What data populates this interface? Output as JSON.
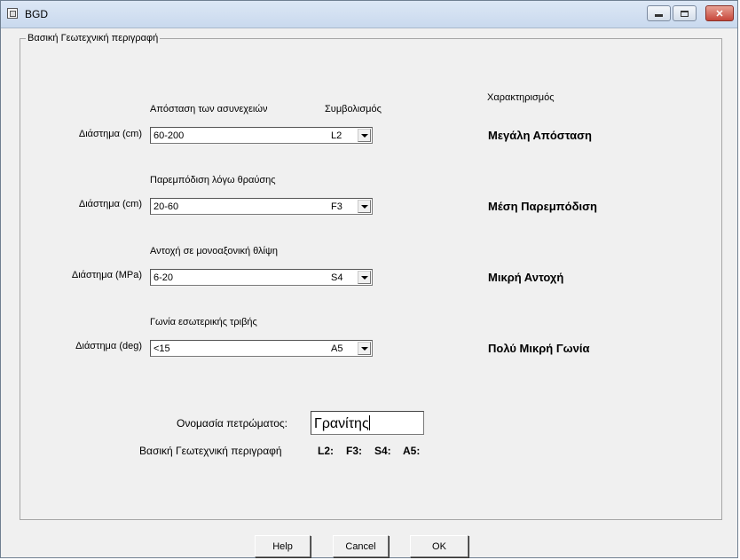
{
  "window": {
    "title": "BGD"
  },
  "group": {
    "legend": "Βασική Γεωτεχνική περιγραφή"
  },
  "headers": {
    "characterization": "Χαρακτηρισμός",
    "symbolism": "Συμβολισμός"
  },
  "rows": [
    {
      "heading": "Απόσταση των ασυνεχειών",
      "label": "Διάστημα (cm)",
      "value": "60-200",
      "symbol": "L2",
      "characterization": "Μεγάλη Απόσταση"
    },
    {
      "heading": "Παρεμπόδιση λόγω θραύσης",
      "label": "Διάστημα (cm)",
      "value": "20-60",
      "symbol": "F3",
      "characterization": "Μέση Παρεμπόδιση"
    },
    {
      "heading": "Αντοχή σε μονοαξονική θλίψη",
      "label": "Διάστημα (MPa)",
      "value": "6-20",
      "symbol": "S4",
      "characterization": "Μικρή Αντοχή"
    },
    {
      "heading": "Γωνία εσωτερικής τριβής",
      "label": "Διάστημα (deg)",
      "value": "<15",
      "symbol": "A5",
      "characterization": "Πολύ Μικρή Γωνία"
    }
  ],
  "rock_name": {
    "label": "Ονομασία πετρώματος:",
    "value": "Γρανίτης"
  },
  "summary": {
    "label": "Βασική Γεωτεχνική περιγραφή",
    "codes": [
      "L2:",
      "F3:",
      "S4:",
      "A5:"
    ]
  },
  "buttons": {
    "help": "Help",
    "cancel": "Cancel",
    "ok": "OK"
  }
}
